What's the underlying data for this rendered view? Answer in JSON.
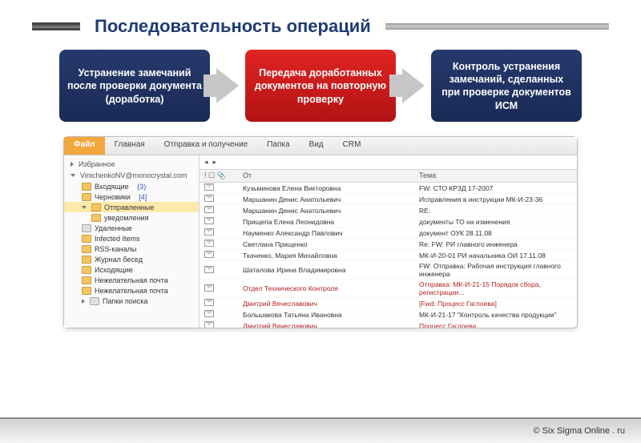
{
  "slide": {
    "title": "Последовательность операций"
  },
  "flow": {
    "step1": "Устранение замечаний после проверки документа (доработка)",
    "step2": "Передача доработанных документов на повторную проверку",
    "step3": "Контроль устранения замечаний, сделанных при проверке документов ИСМ"
  },
  "ribbon": {
    "file": "Файл",
    "tabs": [
      "Главная",
      "Отправка и получение",
      "Папка",
      "Вид",
      "CRM"
    ]
  },
  "sidebar": {
    "fav": "Избранное",
    "account": "VinichenkoNV@monocrystal.com",
    "items": [
      {
        "label": "Входящие",
        "count": "(3)"
      },
      {
        "label": "Черновики",
        "count": "[4]"
      },
      {
        "label": "Отправленные",
        "count": ""
      },
      {
        "label": "уведомления",
        "count": "",
        "sub": true
      },
      {
        "label": "Удаленные",
        "count": ""
      },
      {
        "label": "Infected Items",
        "count": ""
      },
      {
        "label": "RSS-каналы",
        "count": ""
      },
      {
        "label": "Журнал бесед",
        "count": ""
      },
      {
        "label": "Исходящие",
        "count": ""
      },
      {
        "label": "Нежелательная почта",
        "count": ""
      },
      {
        "label": "Нежелательная почта",
        "count": ""
      },
      {
        "label": "Папки поиска",
        "count": ""
      }
    ]
  },
  "list": {
    "header_from": "От",
    "header_subj": "Тема",
    "rows": [
      {
        "from": "Кузьминова Елена Викторовна",
        "subj": "FW: СТО КРЗД 17-2007",
        "red": false
      },
      {
        "from": "Маршанин Денис Анатольевич",
        "subj": "Исправления в инструкции МК-И-23-36",
        "red": false
      },
      {
        "from": "Маршанин Денис Анатольевич",
        "subj": "RE:",
        "red": false
      },
      {
        "from": "Прищепа Елена Леонидовна",
        "subj": "документы ТО на изменения",
        "red": false
      },
      {
        "from": "Науменко Александр Павлович",
        "subj": "документ ОУК 28.11.08",
        "red": false
      },
      {
        "from": "Светлана Прищенко",
        "subj": "Re: FW: РИ главного инженера",
        "red": false
      },
      {
        "from": "Ткаченко, Мария Михайловна",
        "subj": "МК-И-20-01 РИ начальника ОИ 17.11.08",
        "red": false
      },
      {
        "from": "Шаталова Ирина Владимировна",
        "subj": "FW: Отправка: Рабочая инструкция главного инженера",
        "red": false
      },
      {
        "from": "Отдел Технического Контроля",
        "subj": "Отправка: МК-И-21-15 Порядок сбора, регистрации...",
        "red": true
      },
      {
        "from": "Дмитрий Вячеславович",
        "subj": "[Fwd: Процесс Гаглоева]",
        "red": true
      },
      {
        "from": "Большакова Татьяна Ивановна",
        "subj": "МК-И-21-17 \"Контроль качества продукции\"",
        "red": false
      },
      {
        "from": "Дмитрий Вячеславович",
        "subj": "Процесс Гаглоева",
        "red": true
      }
    ]
  },
  "footer": {
    "text": "© Six Sigma Online . ru"
  }
}
